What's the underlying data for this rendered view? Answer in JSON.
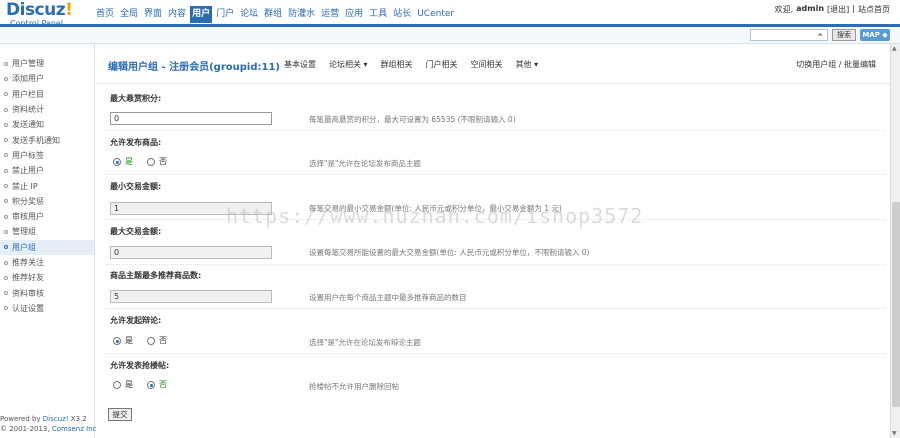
{
  "logo": {
    "name": "Discuz",
    "mark": "!",
    "subtitle": "Control Panel"
  },
  "topnav": [
    "首页",
    "全局",
    "界面",
    "内容",
    "用户",
    "门户",
    "论坛",
    "群组",
    "防灌水",
    "运营",
    "应用",
    "工具",
    "站长",
    "UCenter"
  ],
  "topnav_active": "用户",
  "userbar": {
    "greeting": "欢迎,",
    "username": "admin",
    "logout": "[退出]",
    "sep": "|",
    "home": "站点首页"
  },
  "search": {
    "value": "",
    "button": "搜索",
    "map_button": "MAP ◆"
  },
  "sidebar": {
    "items": [
      "用户管理",
      "添加用户",
      "用户栏目",
      "资料统计",
      "发送通知",
      "发送手机通知",
      "用户标签",
      "禁止用户",
      "禁止 IP",
      "积分奖惩",
      "审核用户",
      "管理组",
      "用户组",
      "推荐关注",
      "推荐好友",
      "资料审核",
      "认证设置"
    ],
    "active": "用户组"
  },
  "footer": {
    "line1_prefix": "Powered by ",
    "line1_brand": "Discuz!",
    "line1_version": " X3.2",
    "line2": "© 2001-2013, ",
    "line2_brand": "Comsenz Inc."
  },
  "page": {
    "title": "编辑用户组 - 注册会员(groupid:11)",
    "tabs": [
      "基本设置",
      "论坛相关 ▾",
      "群组相关",
      "门户相关",
      "空间相关",
      "其他 ▾"
    ],
    "switch_link": "切换用户组 / 批量编辑"
  },
  "form": {
    "max_reward": {
      "label": "最大悬赏积分:",
      "value": "0",
      "desc": "每笔最高悬赏的积分，最大可设置为 65535 (不限制请输入 0)"
    },
    "allow_trade": {
      "label": "允许发布商品:",
      "yes": "是",
      "no": "否",
      "selected": "yes",
      "desc": "选择\"是\"允许在论坛发布商品主题"
    },
    "min_trade": {
      "label": "最小交易金额:",
      "value": "1",
      "desc": "每笔交易的最小交易金额(单位: 人民币元或积分单位，最小交易金额为 1 元)"
    },
    "max_trade": {
      "label": "最大交易金额:",
      "value": "0",
      "desc": "设置每笔交易所能设置的最大交易金额(单位: 人民币元或积分单位，不限制请输入 0)"
    },
    "max_recommend": {
      "label": "商品主题最多推荐商品数:",
      "value": "5",
      "desc": "设置用户在每个商品主题中最多推荐商品的数目"
    },
    "allow_debate": {
      "label": "允许发起辩论:",
      "yes": "是",
      "no": "否",
      "selected": "yes",
      "desc": "选择\"是\"允许在论坛发布辩论主题"
    },
    "allow_rush": {
      "label": "允许发表抢楼帖:",
      "yes": "是",
      "no": "否",
      "selected": "no",
      "desc": "抢楼帖不允许用户删除回帖"
    },
    "submit": "提交"
  },
  "watermark": "https://www.huzhan.com/ishop3572"
}
